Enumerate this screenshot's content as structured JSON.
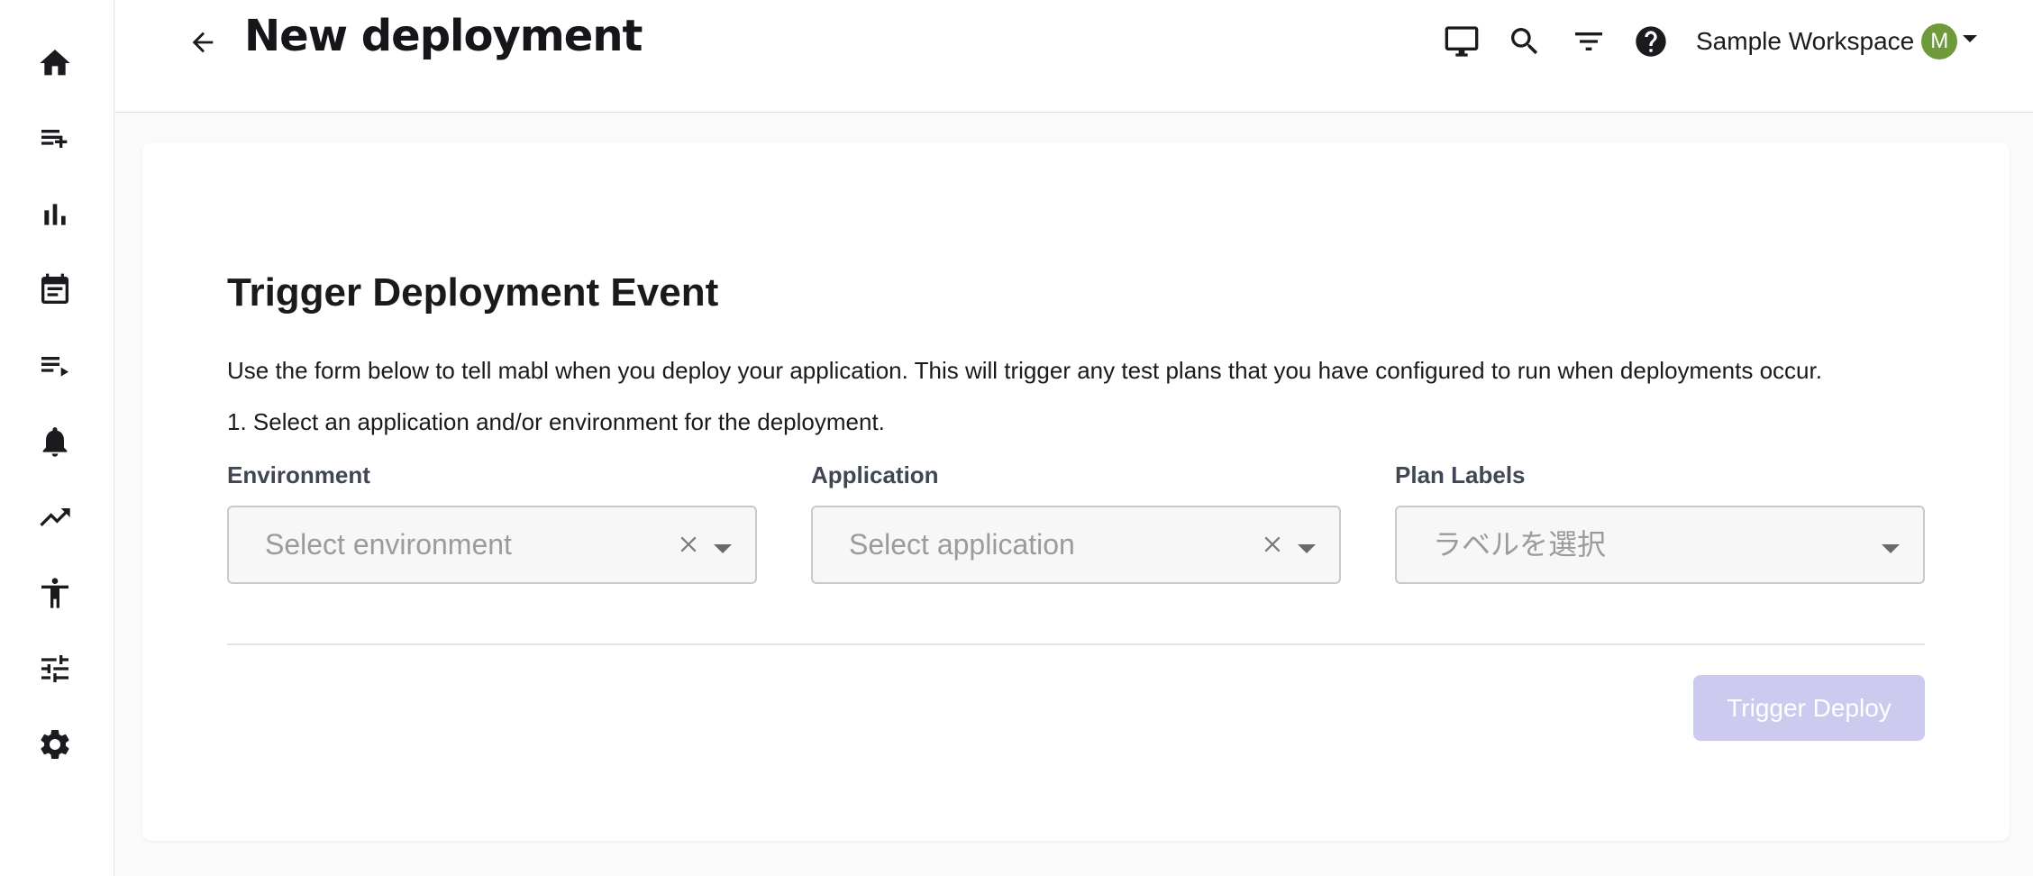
{
  "header": {
    "title": "New deployment",
    "back_icon": "arrow-left-icon",
    "icons": [
      "monitor-icon",
      "search-icon",
      "filter-icon",
      "help-icon"
    ],
    "workspace_name": "Sample Workspace",
    "avatar_initial": "M",
    "avatar_color": "#6f9a3c"
  },
  "sidebar": {
    "items": [
      {
        "icon": "home-icon"
      },
      {
        "icon": "playlist-add-icon"
      },
      {
        "icon": "bar-chart-icon"
      },
      {
        "icon": "calendar-icon"
      },
      {
        "icon": "playlist-play-icon"
      },
      {
        "icon": "bell-icon"
      },
      {
        "icon": "trending-up-icon"
      },
      {
        "icon": "accessibility-icon"
      },
      {
        "icon": "tune-icon"
      },
      {
        "icon": "gear-icon"
      }
    ]
  },
  "form": {
    "title": "Trigger Deployment Event",
    "description": "Use the form below to tell mabl when you deploy your application. This will trigger any test plans that you have configured to run when deployments occur.",
    "step": "1. Select an application and/or environment for the deployment.",
    "environment": {
      "label": "Environment",
      "placeholder": "Select environment"
    },
    "application": {
      "label": "Application",
      "placeholder": "Select application"
    },
    "plan_labels": {
      "label": "Plan Labels",
      "placeholder": "ラベルを選択"
    },
    "submit_label": "Trigger Deploy",
    "submit_color": "#cdcaf0"
  }
}
